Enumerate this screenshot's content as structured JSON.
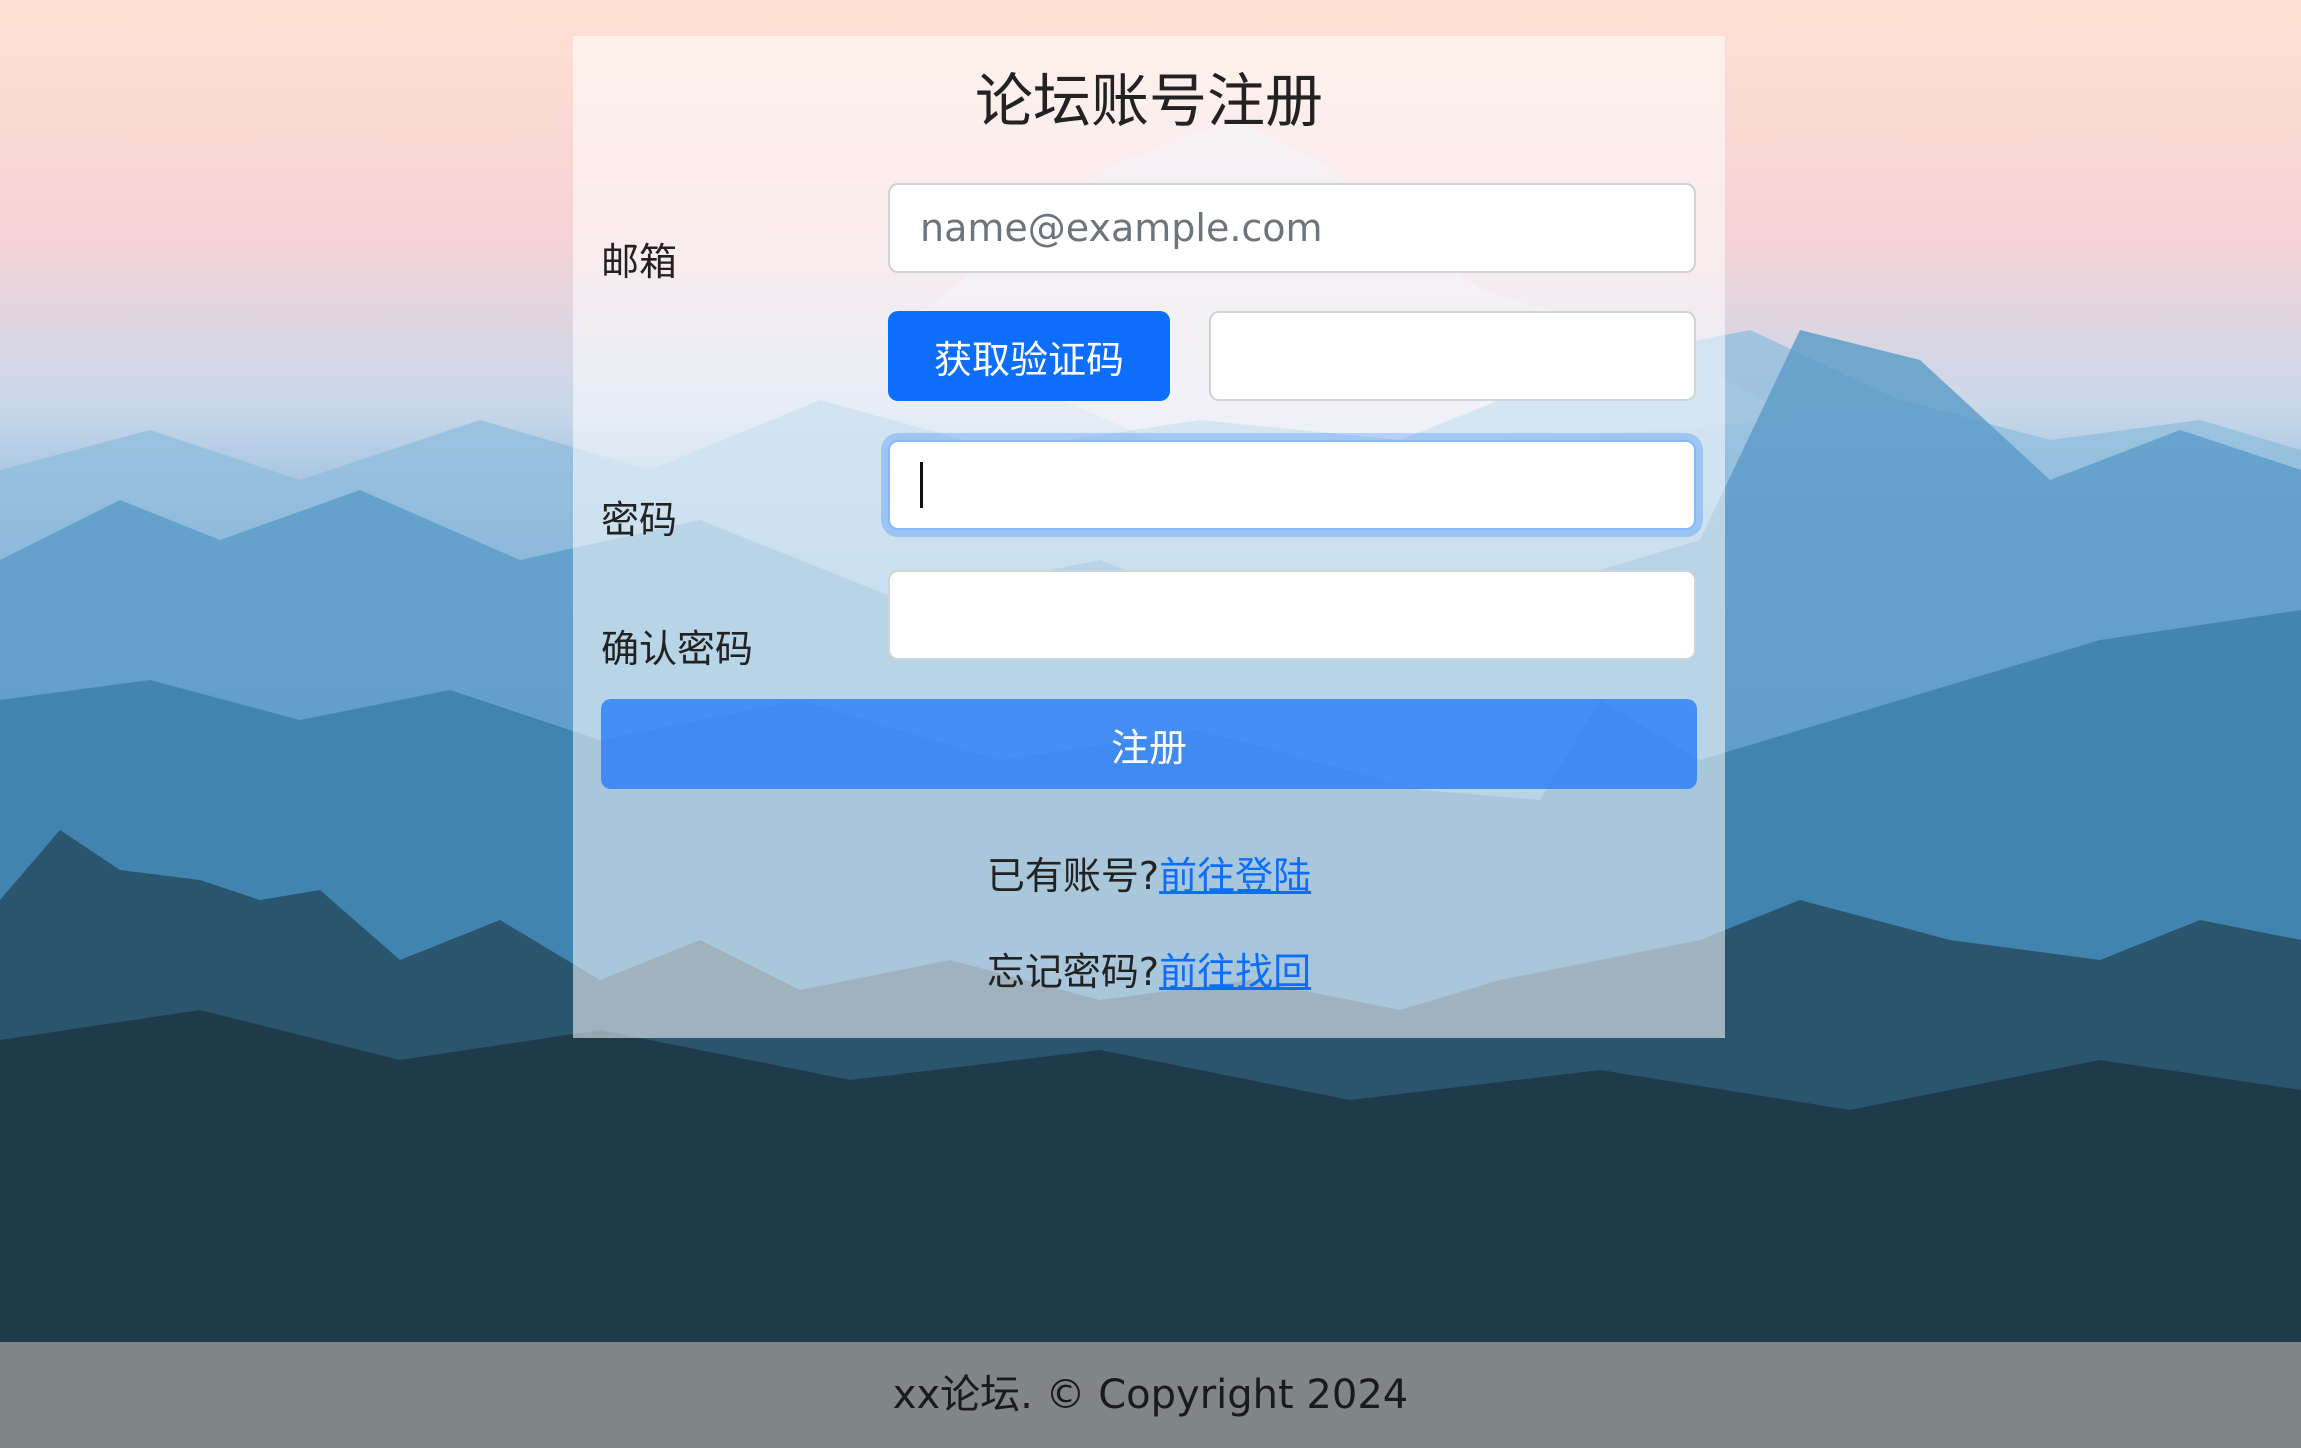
{
  "form": {
    "title": "论坛账号注册",
    "email_label": "邮箱",
    "email_placeholder": "name@example.com",
    "email_value": "",
    "get_code_label": "获取验证码",
    "code_value": "",
    "password_label": "密码",
    "password_value": "",
    "confirm_label": "确认密码",
    "confirm_value": "",
    "register_label": "注册"
  },
  "links": {
    "has_account_text": "已有账号?",
    "login_link": "前往登陆",
    "forgot_text": "忘记密码?",
    "recover_link": "前往找回"
  },
  "footer": {
    "text": "xx论坛. © Copyright 2024"
  },
  "colors": {
    "primary": "#0d6efd",
    "focus_ring": "#86b7fe"
  }
}
